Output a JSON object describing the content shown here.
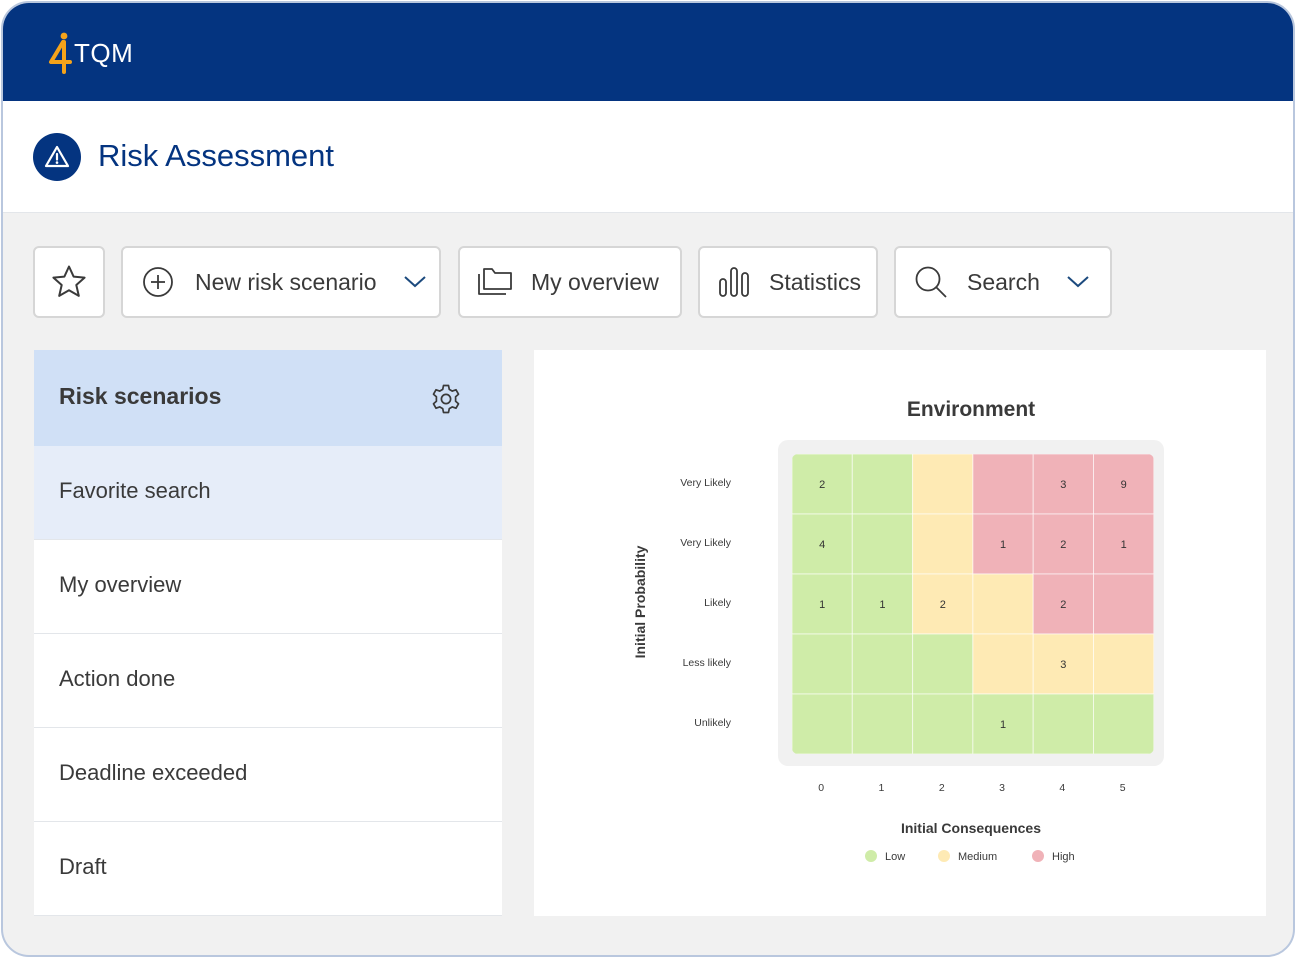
{
  "app": {
    "brand": "TQM",
    "brand_prefix": "4",
    "page_title": "Risk Assessment",
    "colors": {
      "header_bg": "#043480",
      "brand_orange": "#f5a31a",
      "low": "#cfeca8",
      "medium": "#feeab4",
      "high": "#f0b2b8",
      "sidebar_active": "#d0e0f6",
      "sidebar_hover": "#e6edf9"
    }
  },
  "toolbar": {
    "favorite_icon": "star-icon",
    "new_risk_label": "New risk scenario",
    "overview_label": "My overview",
    "statistics_label": "Statistics",
    "search_label": "Search"
  },
  "sidebar": {
    "header": "Risk scenarios",
    "settings_icon": "gear-icon",
    "items": [
      {
        "label": "Favorite search"
      },
      {
        "label": "My overview"
      },
      {
        "label": "Action done"
      },
      {
        "label": "Deadline exceeded"
      },
      {
        "label": "Draft"
      }
    ]
  },
  "chart_data": {
    "type": "heatmap",
    "title": "Environment",
    "xlabel": "Initial Consequences",
    "ylabel": "Initial Probability",
    "x_categories": [
      "0",
      "1",
      "2",
      "3",
      "4",
      "5"
    ],
    "y_categories": [
      "Very Likely",
      "Very Likely",
      "Likely",
      "Less likely",
      "Unlikely"
    ],
    "risk_levels": [
      [
        "Low",
        "Low",
        "Medium",
        "High",
        "High",
        "High"
      ],
      [
        "Low",
        "Low",
        "Medium",
        "High",
        "High",
        "High"
      ],
      [
        "Low",
        "Low",
        "Medium",
        "Medium",
        "High",
        "High"
      ],
      [
        "Low",
        "Low",
        "Low",
        "Medium",
        "Medium",
        "Medium"
      ],
      [
        "Low",
        "Low",
        "Low",
        "Low",
        "Low",
        "Low"
      ]
    ],
    "values": [
      [
        2,
        null,
        null,
        null,
        3,
        9
      ],
      [
        4,
        null,
        null,
        1,
        2,
        1
      ],
      [
        1,
        1,
        2,
        null,
        2,
        null
      ],
      [
        null,
        null,
        null,
        null,
        3,
        null
      ],
      [
        null,
        null,
        null,
        1,
        null,
        null
      ]
    ],
    "legend": [
      {
        "label": "Low",
        "color": "#cfeca8"
      },
      {
        "label": "Medium",
        "color": "#feeab4"
      },
      {
        "label": "High",
        "color": "#f0b2b8"
      }
    ],
    "legend_position": "bottom"
  }
}
